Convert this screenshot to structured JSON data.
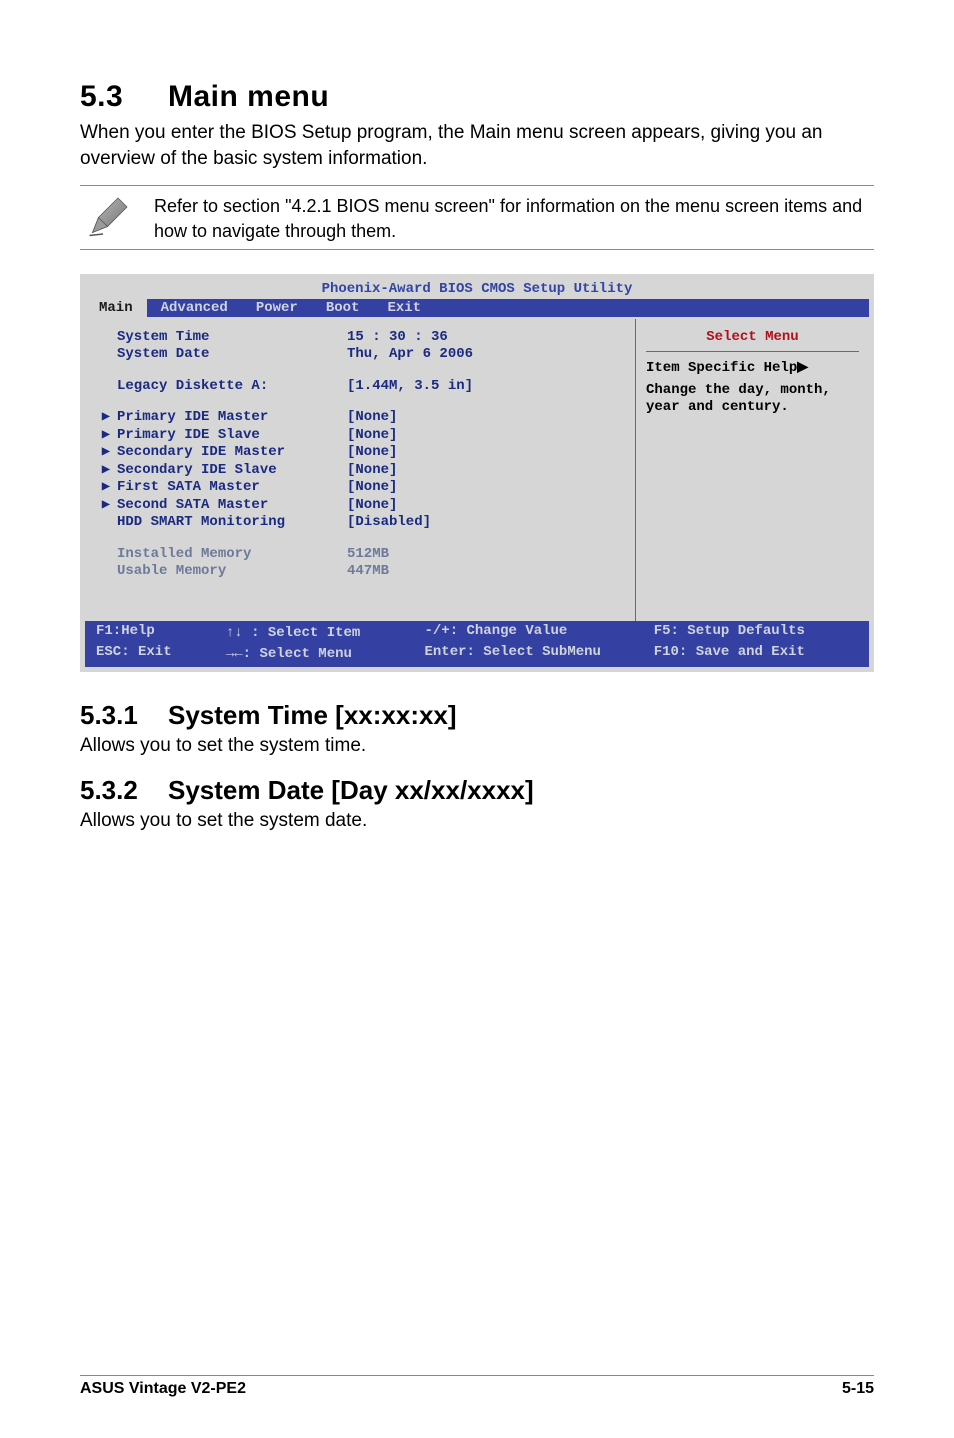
{
  "heading": {
    "number": "5.3",
    "title": "Main menu",
    "intro": "When you enter the BIOS Setup program, the Main menu screen appears, giving you an overview of the basic system information."
  },
  "note": "Refer to section \"4.2.1 BIOS menu screen\" for information on the menu screen items and how to navigate through them.",
  "bios": {
    "title": "Phoenix-Award BIOS CMOS Setup Utility",
    "tabs": [
      "Main",
      "Advanced",
      "Power",
      "Boot",
      "Exit"
    ],
    "active_tab": "Main",
    "rows_top": [
      {
        "label": "System Time",
        "value": "15 : 30 : 36"
      },
      {
        "label": "System Date",
        "value": "Thu, Apr 6  2006"
      }
    ],
    "legacy": {
      "label": "Legacy Diskette A:",
      "value": "[1.44M, 3.5 in]"
    },
    "ide": [
      {
        "label": "Primary IDE Master",
        "value": "[None]",
        "caret": true
      },
      {
        "label": "Primary IDE Slave",
        "value": "[None]",
        "caret": true
      },
      {
        "label": "Secondary IDE Master",
        "value": "[None]",
        "caret": true
      },
      {
        "label": "Secondary IDE Slave",
        "value": "[None]",
        "caret": true
      },
      {
        "label": "First SATA Master",
        "value": "[None]",
        "caret": true
      },
      {
        "label": "Second SATA Master",
        "value": "[None]",
        "caret": true
      },
      {
        "label": "HDD SMART Monitoring",
        "value": "[Disabled]",
        "caret": false
      }
    ],
    "mem": [
      {
        "label": "Installed Memory",
        "value": "512MB"
      },
      {
        "label": "Usable Memory",
        "value": "447MB"
      }
    ],
    "help": {
      "select_menu": "Select Menu",
      "title": "Item Specific Help",
      "body": "Change the day, month, year and century."
    },
    "footer": {
      "f1": "F1:Help",
      "arrows_item": "↑↓ : Select Item",
      "change": "-/+: Change Value",
      "defaults": "F5: Setup Defaults",
      "esc": "ESC: Exit",
      "arrows_menu": "→←: Select Menu",
      "enter": "Enter: Select SubMenu",
      "save": "F10: Save and Exit"
    }
  },
  "subsections": [
    {
      "num": "5.3.1",
      "title": "System Time [xx:xx:xx]",
      "body": "Allows you to set the system time."
    },
    {
      "num": "5.3.2",
      "title": "System Date [Day xx/xx/xxxx]",
      "body": "Allows you to set the system date."
    }
  ],
  "footer": {
    "left": "ASUS Vintage V2-PE2",
    "right": "5-15"
  }
}
